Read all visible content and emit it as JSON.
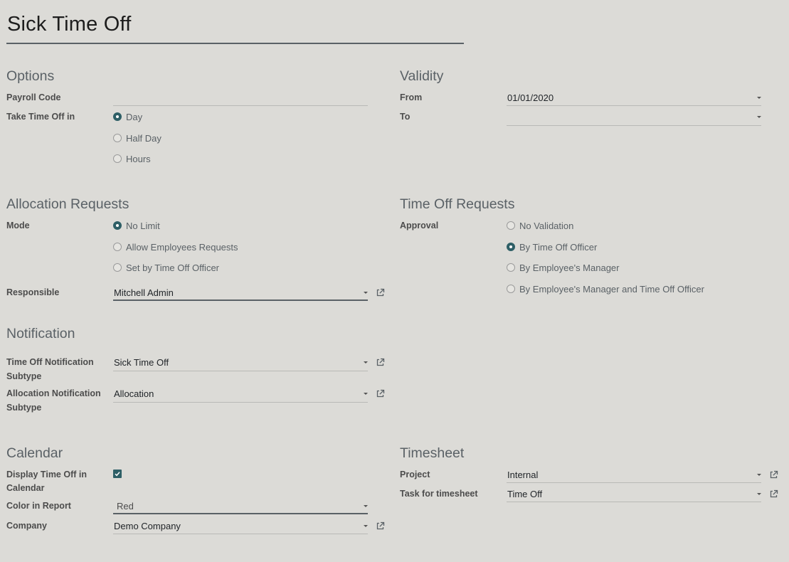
{
  "record_title": "Sick Time Off",
  "options": {
    "title": "Options",
    "payroll_code_label": "Payroll Code",
    "payroll_code_value": "",
    "take_time_off_label": "Take Time Off in",
    "take_time_off_options": [
      "Day",
      "Half Day",
      "Hours"
    ],
    "take_time_off_selected": "Day"
  },
  "validity": {
    "title": "Validity",
    "from_label": "From",
    "from_value": "01/01/2020",
    "to_label": "To",
    "to_value": ""
  },
  "allocation": {
    "title": "Allocation Requests",
    "mode_label": "Mode",
    "mode_options": [
      "No Limit",
      "Allow Employees Requests",
      "Set by Time Off Officer"
    ],
    "mode_selected": "No Limit",
    "responsible_label": "Responsible",
    "responsible_value": "Mitchell Admin"
  },
  "time_off_requests": {
    "title": "Time Off Requests",
    "approval_label": "Approval",
    "approval_options": [
      "No Validation",
      "By Time Off Officer",
      "By Employee's Manager",
      "By Employee's Manager and Time Off Officer"
    ],
    "approval_selected": "By Time Off Officer"
  },
  "notification": {
    "title": "Notification",
    "time_off_subtype_label_1": "Time Off Notification",
    "time_off_subtype_label_2": "Subtype",
    "time_off_subtype_value": "Sick Time Off",
    "allocation_subtype_label_1": "Allocation Notification",
    "allocation_subtype_label_2": "Subtype",
    "allocation_subtype_value": "Allocation"
  },
  "calendar": {
    "title": "Calendar",
    "display_label_1": "Display Time Off in",
    "display_label_2": "Calendar",
    "display_checked": true,
    "color_label": "Color in Report",
    "color_value": "Red",
    "company_label": "Company",
    "company_value": "Demo Company"
  },
  "timesheet": {
    "title": "Timesheet",
    "project_label": "Project",
    "project_value": "Internal",
    "task_label": "Task for timesheet",
    "task_value": "Time Off"
  },
  "colors": {
    "background": "#dcdbd7",
    "accent": "#2e5f66",
    "section_text": "#5a6166"
  }
}
